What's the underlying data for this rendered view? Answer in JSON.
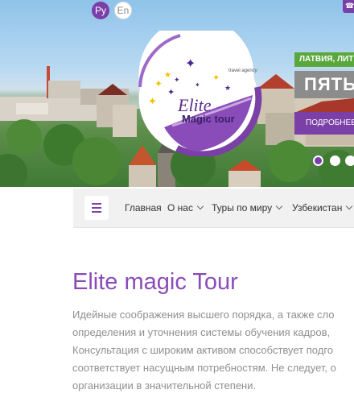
{
  "header": {
    "languages": [
      {
        "code": "ru",
        "label": "Ру",
        "active": true
      },
      {
        "code": "en",
        "label": "En",
        "active": false
      }
    ],
    "phone_icon": "phone-icon"
  },
  "logo": {
    "line1": "Elite",
    "line2": "Magic tour",
    "subtitle": "travel agency"
  },
  "slider": {
    "tag": "ЛАТВИЯ, ЛИТ",
    "title": "ПЯТЬ",
    "button": "ПОДРОБНЕЕ",
    "active_slide": 1,
    "slide_count": 3
  },
  "nav": {
    "menu_icon": "hamburger-icon",
    "items": [
      {
        "label": "Главная",
        "has_dropdown": false
      },
      {
        "label": "О нас",
        "has_dropdown": true
      },
      {
        "label": "Туры по миру",
        "has_dropdown": true
      },
      {
        "label": "Узбекистан",
        "has_dropdown": true
      }
    ]
  },
  "content": {
    "title": "Elite magic Tour",
    "paragraph_lines": [
      "Идейные соображения высшего порядка, а также сло",
      "определения и уточнения системы обучения кадров,",
      "Консультация с широким активом способствует подго",
      "соответствует насущным потребностям. Не следует, о",
      "организации в значительной степени."
    ]
  },
  "colors": {
    "accent": "#7b3fa8",
    "title": "#8a4cb8",
    "tag_green": "#5aa83c",
    "text_gray": "#8f8f8f"
  }
}
